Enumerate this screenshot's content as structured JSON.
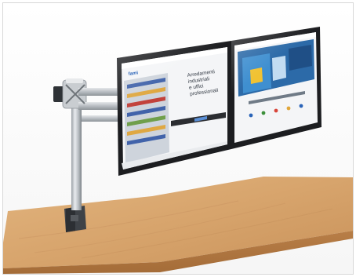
{
  "photo": {
    "left_screen": {
      "headline_lines": [
        "Arredamenti",
        "industriali",
        "e uffici",
        "professionali"
      ],
      "logo_text": "fami"
    },
    "right_screen": {}
  }
}
